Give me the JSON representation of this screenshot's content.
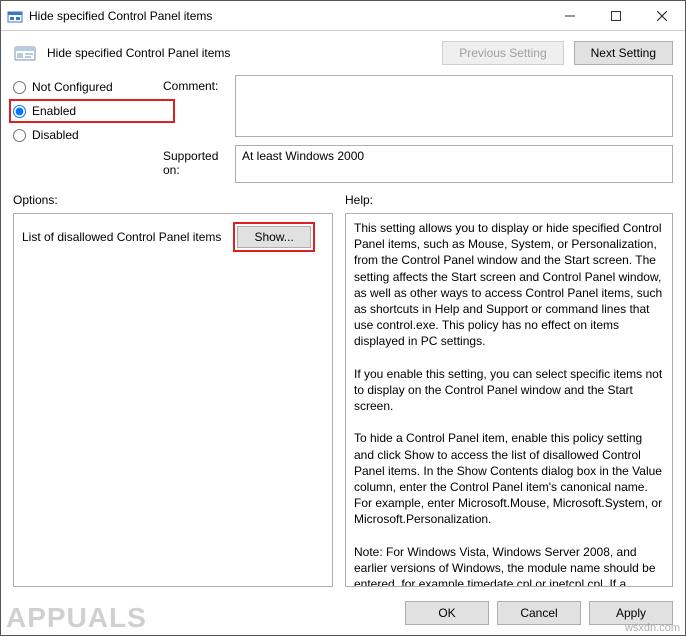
{
  "window": {
    "title": "Hide specified Control Panel items"
  },
  "header": {
    "policy_name": "Hide specified Control Panel items",
    "prev_label": "Previous Setting",
    "next_label": "Next Setting"
  },
  "radios": {
    "not_configured": "Not Configured",
    "enabled": "Enabled",
    "disabled": "Disabled",
    "selected": "enabled"
  },
  "fields": {
    "comment_label": "Comment:",
    "comment_value": "",
    "supported_label": "Supported on:",
    "supported_value": "At least Windows 2000"
  },
  "options": {
    "label": "Options:",
    "item_label": "List of disallowed Control Panel items",
    "show_label": "Show..."
  },
  "help": {
    "label": "Help:",
    "text": "This setting allows you to display or hide specified Control Panel items, such as Mouse, System, or Personalization, from the Control Panel window and the Start screen. The setting affects the Start screen and Control Panel window, as well as other ways to access Control Panel items, such as shortcuts in Help and Support or command lines that use control.exe. This policy has no effect on items displayed in PC settings.\n\nIf you enable this setting, you can select specific items not to display on the Control Panel window and the Start screen.\n\nTo hide a Control Panel item, enable this policy setting and click Show to access the list of disallowed Control Panel items. In the Show Contents dialog box in the Value column, enter the Control Panel item's canonical name. For example, enter Microsoft.Mouse, Microsoft.System, or Microsoft.Personalization.\n\nNote: For Windows Vista, Windows Server 2008, and earlier versions of Windows, the module name should be entered, for example timedate.cpl or inetcpl.cpl. If a Control Panel item does"
  },
  "footer": {
    "ok": "OK",
    "cancel": "Cancel",
    "apply": "Apply"
  },
  "watermark": {
    "brand": "APPUALS",
    "site": "wsxdn.com"
  }
}
